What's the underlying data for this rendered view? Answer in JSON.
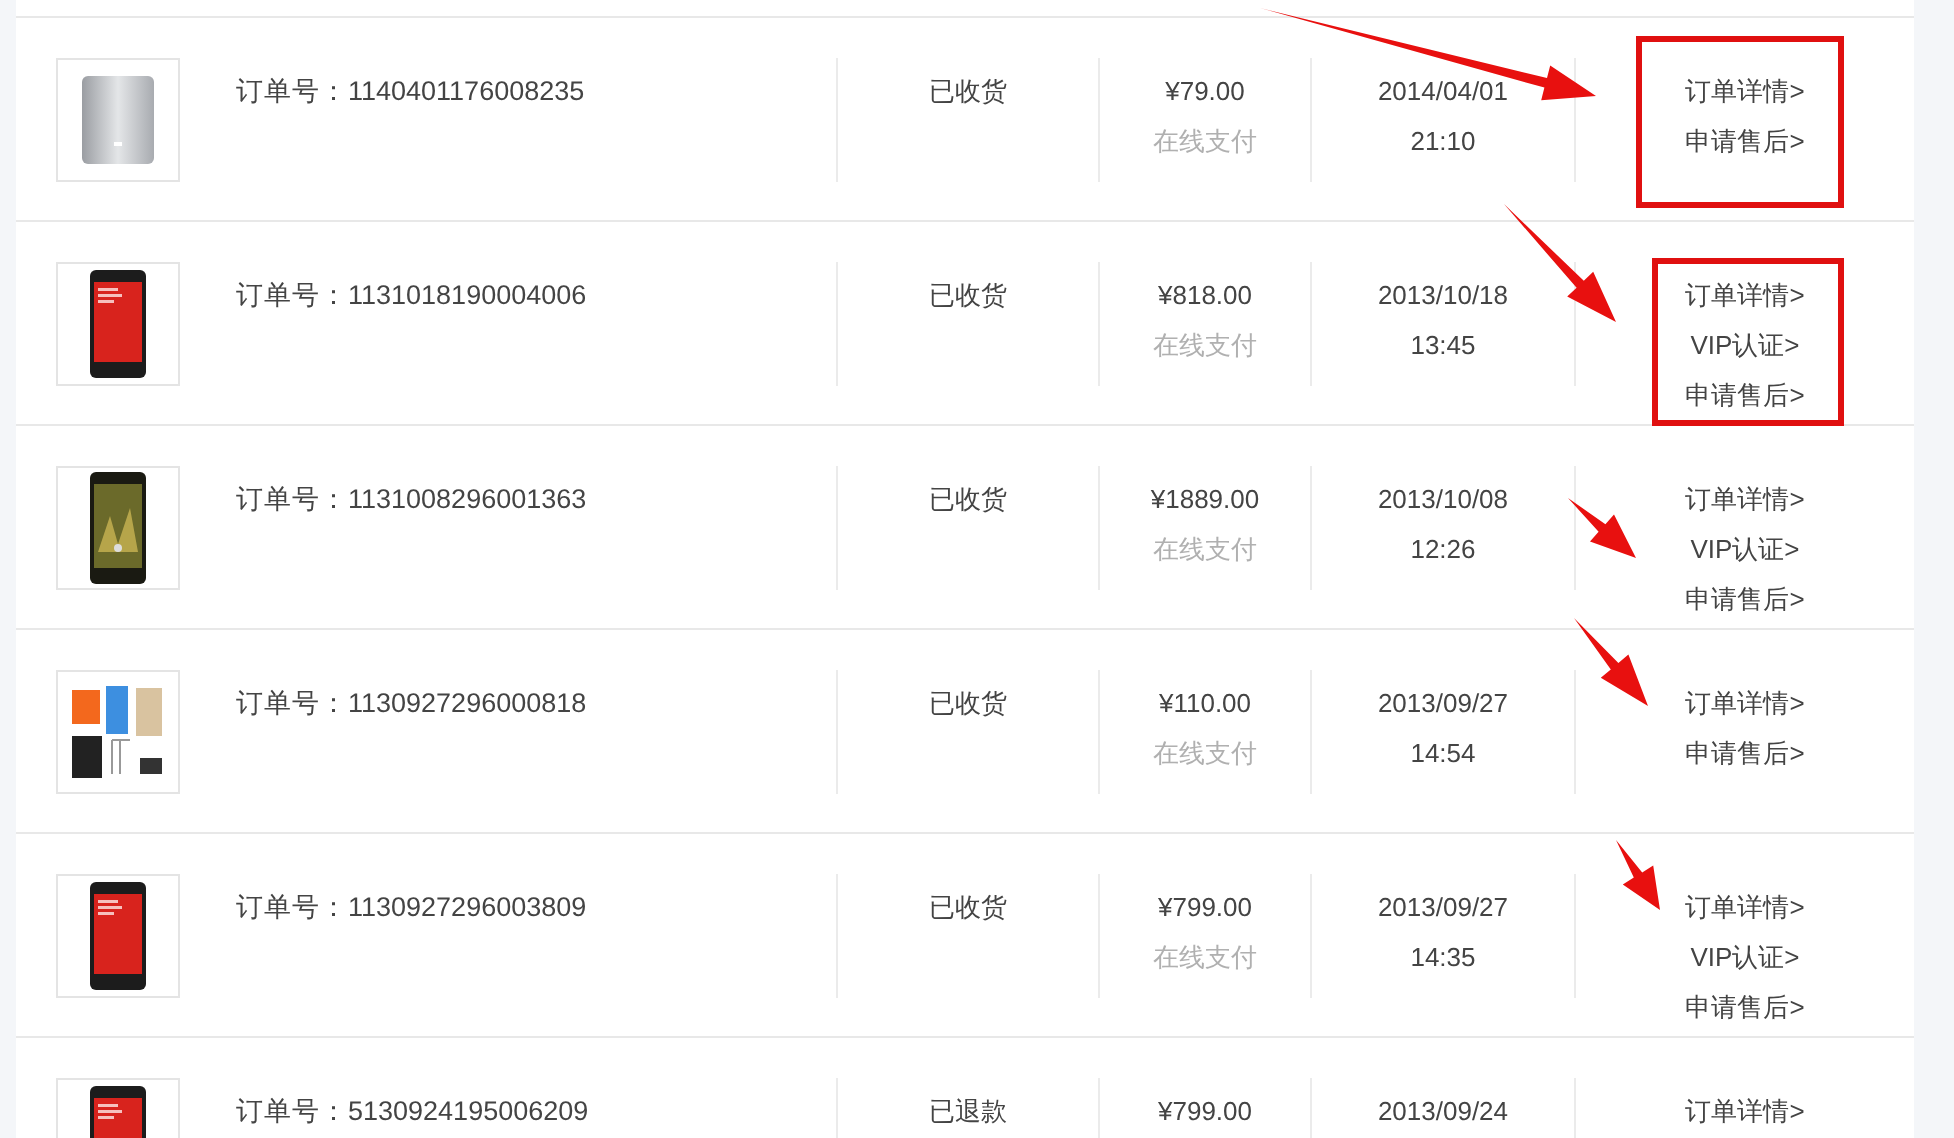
{
  "orders": [
    {
      "product": {
        "kind": "power-bank"
      },
      "order_no": "订单号：1140401176008235",
      "status": "已收货",
      "price": "¥79.00",
      "payment": "在线支付",
      "date": "2014/04/01",
      "time": "21:10",
      "actions": [
        "订单详情>",
        "申请售后>"
      ],
      "boxed": true,
      "arrowed": true
    },
    {
      "product": {
        "kind": "phone-red"
      },
      "order_no": "订单号：1131018190004006",
      "status": "已收货",
      "price": "¥818.00",
      "payment": "在线支付",
      "date": "2013/10/18",
      "time": "13:45",
      "actions": [
        "订单详情>",
        "VIP认证>",
        "申请售后>"
      ],
      "boxed": true,
      "arrowed": true
    },
    {
      "product": {
        "kind": "phone-dark"
      },
      "order_no": "订单号：1131008296001363",
      "status": "已收货",
      "price": "¥1889.00",
      "payment": "在线支付",
      "date": "2013/10/08",
      "time": "12:26",
      "actions": [
        "订单详情>",
        "VIP认证>",
        "申请售后>"
      ],
      "boxed": false,
      "arrowed": true
    },
    {
      "product": {
        "kind": "accessories"
      },
      "order_no": "订单号：1130927296000818",
      "status": "已收货",
      "price": "¥110.00",
      "payment": "在线支付",
      "date": "2013/09/27",
      "time": "14:54",
      "actions": [
        "订单详情>",
        "申请售后>"
      ],
      "boxed": false,
      "arrowed": true
    },
    {
      "product": {
        "kind": "phone-red"
      },
      "order_no": "订单号：1130927296003809",
      "status": "已收货",
      "price": "¥799.00",
      "payment": "在线支付",
      "date": "2013/09/27",
      "time": "14:35",
      "actions": [
        "订单详情>",
        "VIP认证>",
        "申请售后>"
      ],
      "boxed": false,
      "arrowed": true
    },
    {
      "product": {
        "kind": "phone-red"
      },
      "order_no": "订单号：5130924195006209",
      "status": "已退款",
      "price": "¥799.00",
      "date": "2013/09/24",
      "actions": [
        "订单详情>"
      ],
      "boxed": false,
      "arrowed": false
    }
  ]
}
